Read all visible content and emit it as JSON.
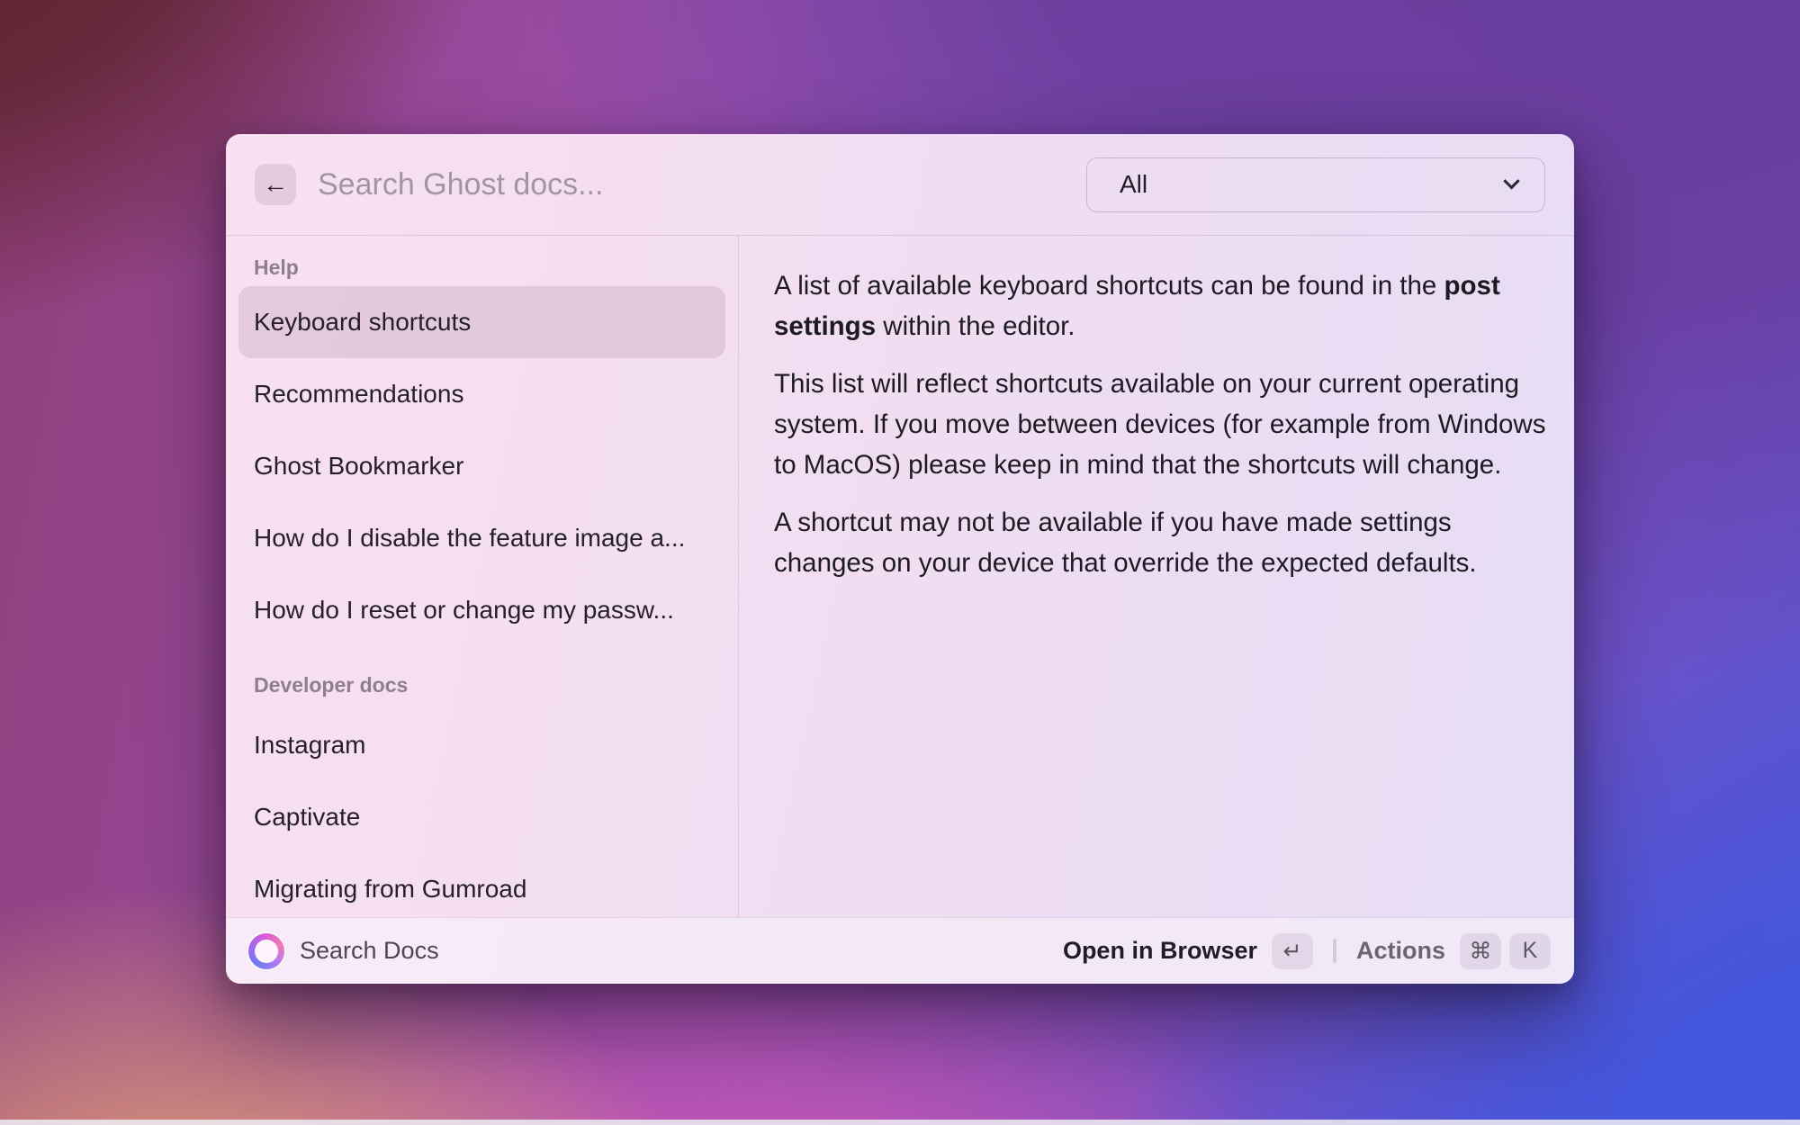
{
  "search": {
    "placeholder": "Search Ghost docs...",
    "value": ""
  },
  "filter_dropdown": {
    "value": "All"
  },
  "sidebar": {
    "sections": [
      {
        "header": "Help",
        "items": [
          {
            "label": "Keyboard shortcuts",
            "selected": true
          },
          {
            "label": "Recommendations",
            "selected": false
          },
          {
            "label": "Ghost Bookmarker",
            "selected": false
          },
          {
            "label": "How do I disable the feature image a...",
            "selected": false
          },
          {
            "label": "How do I reset or change my passw...",
            "selected": false
          }
        ]
      },
      {
        "header": "Developer docs",
        "items": [
          {
            "label": "Instagram",
            "selected": false
          },
          {
            "label": "Captivate",
            "selected": false
          },
          {
            "label": "Migrating from Gumroad",
            "selected": false
          }
        ]
      }
    ]
  },
  "detail": {
    "paragraph1": {
      "pre": "A list of available keyboard shortcuts can be found in the ",
      "bold": "post settings",
      "post": " within the editor."
    },
    "paragraph2": "This list will reflect shortcuts available on your current operating system. If you move between devices (for example from Windows to MacOS) please keep in mind that the shortcuts will change.",
    "paragraph3": "A shortcut may not be available if you have made settings changes on your device that override the expected defaults."
  },
  "footer": {
    "source_label": "Search Docs",
    "primary_action": {
      "label": "Open in Browser",
      "key": "↵"
    },
    "secondary_action": {
      "label": "Actions",
      "key1": "⌘",
      "key2": "K"
    }
  },
  "icons": {
    "back": "←"
  },
  "colors": {
    "selection_highlight": "rgba(122,86,120,0.16)",
    "window_pink": "#f4def1",
    "window_lavender": "#e6def5",
    "bg_maroon": "#5e242e",
    "bg_orange": "#dd9a74",
    "bg_blue": "#4156dd",
    "bg_magenta": "#c957b4",
    "bg_purple": "#6a3d9d"
  }
}
